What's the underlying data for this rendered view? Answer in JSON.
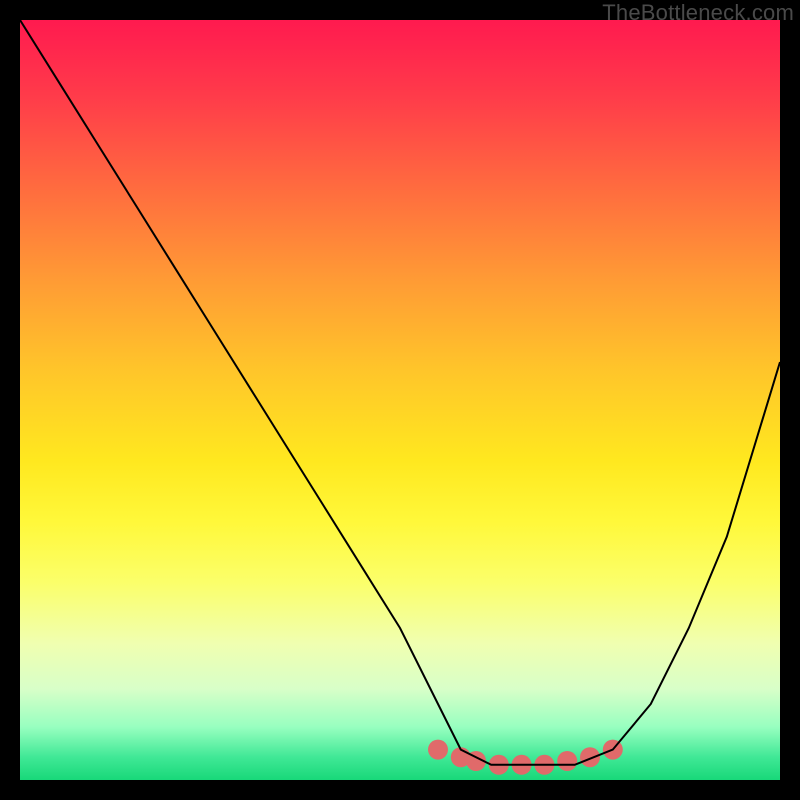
{
  "watermark": "TheBottleneck.com",
  "chart_data": {
    "type": "line",
    "title": "",
    "xlabel": "",
    "ylabel": "",
    "xlim": [
      0,
      100
    ],
    "ylim": [
      0,
      100
    ],
    "series": [
      {
        "name": "bottleneck-curve",
        "x": [
          0,
          5,
          10,
          15,
          20,
          25,
          30,
          35,
          40,
          45,
          50,
          55,
          58,
          62,
          68,
          73,
          78,
          83,
          88,
          93,
          100
        ],
        "values": [
          100,
          92,
          84,
          76,
          68,
          60,
          52,
          44,
          36,
          28,
          20,
          10,
          4,
          2,
          2,
          2,
          4,
          10,
          20,
          32,
          55
        ]
      }
    ],
    "plateau_marker": {
      "name": "plateau-dots",
      "x": [
        55,
        58,
        60,
        63,
        66,
        69,
        72,
        75,
        78
      ],
      "values": [
        4,
        3,
        2.5,
        2,
        2,
        2,
        2.5,
        3,
        4
      ],
      "color": "#e06a6a",
      "point_radius_px": 10
    },
    "colors": {
      "curve": "#000000",
      "background_top": "#ff1a4f",
      "background_bottom": "#18d879",
      "frame": "#000000"
    }
  }
}
